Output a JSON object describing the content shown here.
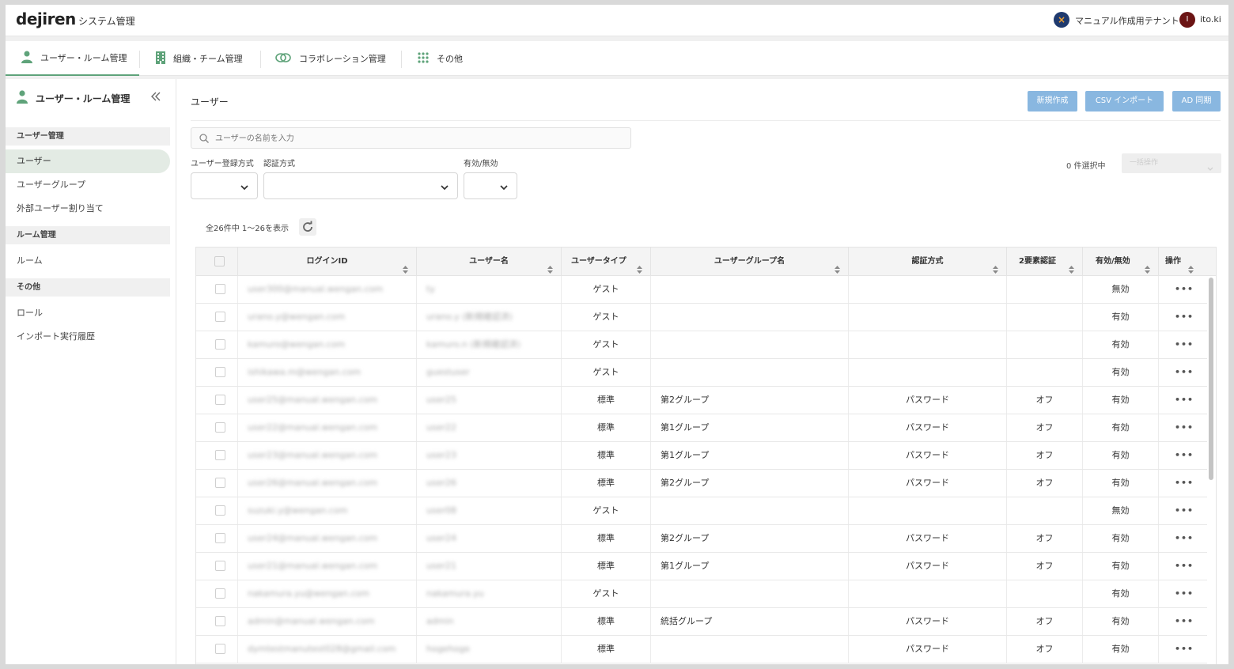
{
  "header": {
    "logo": "dejiren",
    "app_title": "システム管理",
    "tenant_icon": "×",
    "tenant_name": "マニュアル作成用テナント",
    "user_initial": "I",
    "user_name": "ito.ki"
  },
  "top_nav": [
    {
      "label": "ユーザー・ルーム管理",
      "icon": "person-icon",
      "active": true
    },
    {
      "label": "組織・チーム管理",
      "icon": "building-icon",
      "active": false
    },
    {
      "label": "コラボレーション管理",
      "icon": "link-icon",
      "active": false
    },
    {
      "label": "その他",
      "icon": "grid-icon",
      "active": false
    }
  ],
  "sidebar": {
    "title": "ユーザー・ルーム管理",
    "collapse_icon": "double-chevron-left-icon",
    "sections": [
      {
        "heading": "ユーザー管理",
        "items": [
          "ユーザー",
          "ユーザーグループ",
          "外部ユーザー割り当て"
        ]
      },
      {
        "heading": "ルーム管理",
        "items": [
          "ルーム"
        ]
      },
      {
        "heading": "その他",
        "items": [
          "ロール",
          "インポート実行履歴"
        ]
      }
    ],
    "active_item": "ユーザー"
  },
  "main": {
    "title": "ユーザー",
    "buttons": {
      "new": "新規作成",
      "csv_import": "CSV インポート",
      "ad_sync": "AD 同期"
    },
    "search_placeholder": "ユーザーの名前を入力",
    "filters": {
      "registration_method": "ユーザー登録方式",
      "auth_method": "認証方式",
      "enabled": "有効/無効"
    },
    "selected_count": "0 件選択中",
    "bulk_action": "一括操作",
    "count_text": "全26件中 1〜26を表示"
  },
  "table": {
    "columns": [
      "ログインID",
      "ユーザー名",
      "ユーザータイプ",
      "ユーザーグループ名",
      "認証方式",
      "2要素認証",
      "有効/無効",
      "操作"
    ],
    "action_glyph": "•••",
    "rows": [
      {
        "login": "user300@manual.wengan.com",
        "name": "ty",
        "type": "ゲスト",
        "group": "",
        "auth": "",
        "twofa": "",
        "status": "無効"
      },
      {
        "login": "urano.y@wengan.com",
        "name": "urano.y (新規確認済)",
        "type": "ゲスト",
        "group": "",
        "auth": "",
        "twofa": "",
        "status": "有効"
      },
      {
        "login": "kamuro@wengan.com",
        "name": "kamuro.n (新規確認済)",
        "type": "ゲスト",
        "group": "",
        "auth": "",
        "twofa": "",
        "status": "有効"
      },
      {
        "login": "ishikawa.m@wengan.com",
        "name": "guestuser",
        "type": "ゲスト",
        "group": "",
        "auth": "",
        "twofa": "",
        "status": "有効"
      },
      {
        "login": "user25@manual.wengan.com",
        "name": "user25",
        "type": "標準",
        "group": "第2グループ",
        "auth": "パスワード",
        "twofa": "オフ",
        "status": "有効"
      },
      {
        "login": "user22@manual.wengan.com",
        "name": "user22",
        "type": "標準",
        "group": "第1グループ",
        "auth": "パスワード",
        "twofa": "オフ",
        "status": "有効"
      },
      {
        "login": "user23@manual.wengan.com",
        "name": "user23",
        "type": "標準",
        "group": "第1グループ",
        "auth": "パスワード",
        "twofa": "オフ",
        "status": "有効"
      },
      {
        "login": "user26@manual.wengan.com",
        "name": "user26",
        "type": "標準",
        "group": "第2グループ",
        "auth": "パスワード",
        "twofa": "オフ",
        "status": "有効"
      },
      {
        "login": "suzuki.y@wengan.com",
        "name": "user08",
        "type": "ゲスト",
        "group": "",
        "auth": "",
        "twofa": "",
        "status": "無効"
      },
      {
        "login": "user24@manual.wengan.com",
        "name": "user24",
        "type": "標準",
        "group": "第2グループ",
        "auth": "パスワード",
        "twofa": "オフ",
        "status": "有効"
      },
      {
        "login": "user21@manual.wengan.com",
        "name": "user21",
        "type": "標準",
        "group": "第1グループ",
        "auth": "パスワード",
        "twofa": "オフ",
        "status": "有効"
      },
      {
        "login": "nakamura.yu@wengan.com",
        "name": "nakamura.yu",
        "type": "ゲスト",
        "group": "",
        "auth": "",
        "twofa": "",
        "status": "有効"
      },
      {
        "login": "admin@manual.wengan.com",
        "name": "admin",
        "type": "標準",
        "group": "統括グループ",
        "auth": "パスワード",
        "twofa": "オフ",
        "status": "有効"
      },
      {
        "login": "dymtestmanutest028@gmail.com",
        "name": "hogehoge",
        "type": "標準",
        "group": "",
        "auth": "パスワード",
        "twofa": "オフ",
        "status": "有効"
      }
    ]
  },
  "colors": {
    "accent_green": "#5fa37a",
    "button_blue": "#89b7e0",
    "active_bg": "#e3ebe4"
  }
}
